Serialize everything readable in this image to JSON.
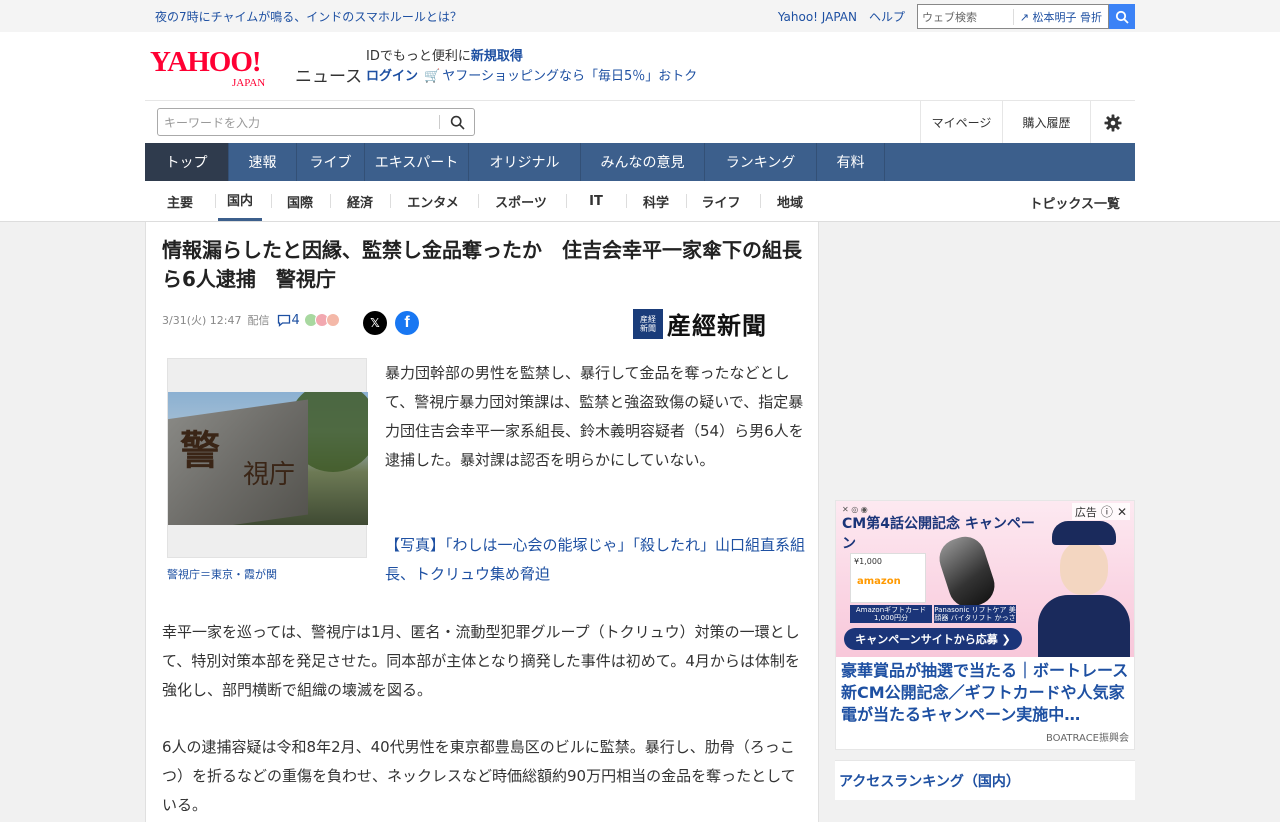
{
  "topbar": {
    "announcement": "夜の7時にチャイムが鳴る、インドのスマホルールとは？",
    "yahoo_japan": "Yahoo! JAPAN",
    "help": "ヘルプ",
    "web_search_placeholder": "ウェブ検索",
    "web_search_suggestion": "松本明子 骨折"
  },
  "header": {
    "logo_text": "YAHOO!",
    "logo_sub": "JAPAN",
    "service_name": "ニュース",
    "promo_prefix": "IDでもっと便利に",
    "promo_register": "新規取得",
    "login": "ログイン",
    "shopping": "ヤフーショッピングなら「毎日5％」おトク"
  },
  "search": {
    "placeholder": "キーワードを入力"
  },
  "utility": {
    "mypage": "マイページ",
    "purchase_history": "購入履歴"
  },
  "global_nav": [
    {
      "label": "トップ",
      "active": true
    },
    {
      "label": "速報",
      "active": false
    },
    {
      "label": "ライブ",
      "active": false
    },
    {
      "label": "エキスパート",
      "active": false
    },
    {
      "label": "オリジナル",
      "active": false
    },
    {
      "label": "みんなの意見",
      "active": false
    },
    {
      "label": "ランキング",
      "active": false
    },
    {
      "label": "有料",
      "active": false
    }
  ],
  "category_nav": {
    "items": [
      "主要",
      "国内",
      "国際",
      "経済",
      "エンタメ",
      "スポーツ",
      "IT",
      "科学",
      "ライフ",
      "地域"
    ],
    "active": "国内",
    "topics_list": "トピックス一覧"
  },
  "article": {
    "headline": "情報漏らしたと因縁、監禁し金品奪ったか　住吉会幸平一家傘下の組長ら6人逮捕　警視庁",
    "datetime": "3/31(火) 12:47",
    "distribution": "配信",
    "comment_count": "4",
    "source": "産經新聞",
    "source_seal": "産経新聞",
    "photo_caption": "警視庁＝東京・霞が関",
    "photo_sign_main": "警",
    "photo_sign_sub": "視庁",
    "paragraph1": "暴力団幹部の男性を監禁し、暴行して金品を奪ったなどとして、警視庁暴力団対策課は、監禁と強盗致傷の疑いで、指定暴力団住吉会幸平一家系組長、鈴木義明容疑者（54）ら男6人を逮捕した。暴対課は認否を明らかにしていない。",
    "related_link": "【写真】「わしは一心会の能塚じゃ」「殺したれ」山口組直系組長、トクリュウ集め脅迫",
    "paragraph2": "幸平一家を巡っては、警視庁は1月、匿名・流動型犯罪グループ（トクリュウ）対策の一環として、特別対策本部を発足させた。同本部が主体となり摘発した事件は初めて。4月からは体制を強化し、部門横断で組織の壊滅を図る。",
    "paragraph3": "6人の逮捕容疑は令和8年2月、40代男性を東京都豊島区のビルに監禁。暴行し、肋骨（ろっこつ）を折るなどの重傷を負わせ、ネックレスなど時価総額約90万円相当の金品を奪ったとしている。"
  },
  "ad": {
    "label": "広告",
    "banner": "CM第4話公開記念 キャンペーン",
    "card_value": "¥1,000",
    "card_brand": "amazon",
    "caption_left": "Amazonギフトカード 1,000円分",
    "caption_right": "Panasonic リフトケア 美顔器 バイタリフト かっさ",
    "cta": "キャンペーンサイトから応募 ❯",
    "title": "豪華賞品が抽選で当たる｜ボートレース新CM公開記念／ギフトカードや人気家電が当たるキャンペーン実施中…",
    "sponsor": "BOATRACE振興会"
  },
  "sidebar": {
    "ranking_title": "アクセスランキング（国内）"
  },
  "colors": {
    "nav_blue": "#3c5f8c",
    "nav_active": "#2f3b4d",
    "link_blue": "#1e50a2",
    "yahoo_red": "#ff0033"
  }
}
